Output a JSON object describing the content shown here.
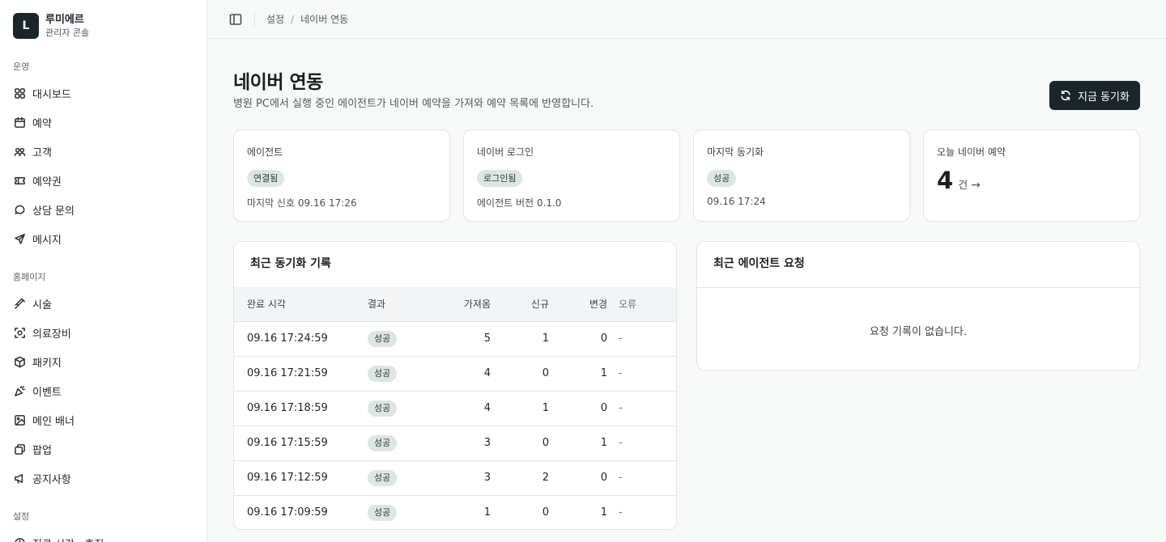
{
  "brand": {
    "logo_letter": "L",
    "name": "루미에르",
    "subtitle": "관리자 콘솔"
  },
  "sidebar": {
    "groups": [
      {
        "title": "운영",
        "items": [
          {
            "label": "대시보드",
            "icon": "grid-icon"
          },
          {
            "label": "예약",
            "icon": "calendar-icon"
          },
          {
            "label": "고객",
            "icon": "users-icon"
          },
          {
            "label": "예약권",
            "icon": "ticket-icon"
          },
          {
            "label": "상담 문의",
            "icon": "chat-icon"
          },
          {
            "label": "메시지",
            "icon": "send-icon"
          }
        ]
      },
      {
        "title": "홈페이지",
        "items": [
          {
            "label": "시술",
            "icon": "syringe-icon"
          },
          {
            "label": "의료장비",
            "icon": "scan-icon"
          },
          {
            "label": "패키지",
            "icon": "box-icon"
          },
          {
            "label": "이벤트",
            "icon": "party-icon"
          },
          {
            "label": "메인 배너",
            "icon": "image-icon"
          },
          {
            "label": "팝업",
            "icon": "layers-icon"
          },
          {
            "label": "공지사항",
            "icon": "megaphone-icon"
          }
        ]
      },
      {
        "title": "설정",
        "items": [
          {
            "label": "진료 시간 · 휴진",
            "icon": "clock-icon"
          }
        ]
      }
    ]
  },
  "breadcrumb": {
    "parent": "설정",
    "separator": "/",
    "current": "네이버 연동"
  },
  "page": {
    "title": "네이버 연동",
    "description": "병원 PC에서 실행 중인 에이전트가 네이버 예약을 가져와 예약 목록에 반영합니다.",
    "sync_button": "지금 동기화"
  },
  "stats": {
    "agent": {
      "label": "에이전트",
      "badge": "연결됨",
      "sub": "마지막 신호 09.16 17:26"
    },
    "login": {
      "label": "네이버 로그인",
      "badge": "로그인됨",
      "sub": "에이전트 버전 0.1.0"
    },
    "last_sync": {
      "label": "마지막 동기화",
      "badge": "성공",
      "sub": "09.16 17:24"
    },
    "today": {
      "label": "오늘 네이버 예약",
      "value": "4",
      "unit": "건",
      "arrow": "→"
    }
  },
  "sync_log": {
    "title": "최근 동기화 기록",
    "columns": [
      "완료 시각",
      "결과",
      "가져옴",
      "신규",
      "변경",
      "오류"
    ],
    "rows": [
      {
        "time": "09.16 17:24:59",
        "result": "성공",
        "fetched": "5",
        "new": "1",
        "changed": "0",
        "error": "-"
      },
      {
        "time": "09.16 17:21:59",
        "result": "성공",
        "fetched": "4",
        "new": "0",
        "changed": "1",
        "error": "-"
      },
      {
        "time": "09.16 17:18:59",
        "result": "성공",
        "fetched": "4",
        "new": "1",
        "changed": "0",
        "error": "-"
      },
      {
        "time": "09.16 17:15:59",
        "result": "성공",
        "fetched": "3",
        "new": "0",
        "changed": "1",
        "error": "-"
      },
      {
        "time": "09.16 17:12:59",
        "result": "성공",
        "fetched": "3",
        "new": "2",
        "changed": "0",
        "error": "-"
      },
      {
        "time": "09.16 17:09:59",
        "result": "성공",
        "fetched": "1",
        "new": "0",
        "changed": "1",
        "error": "-"
      }
    ]
  },
  "agent_requests": {
    "title": "최근 에이전트 요청",
    "empty_text": "요청 기록이 없습니다."
  }
}
